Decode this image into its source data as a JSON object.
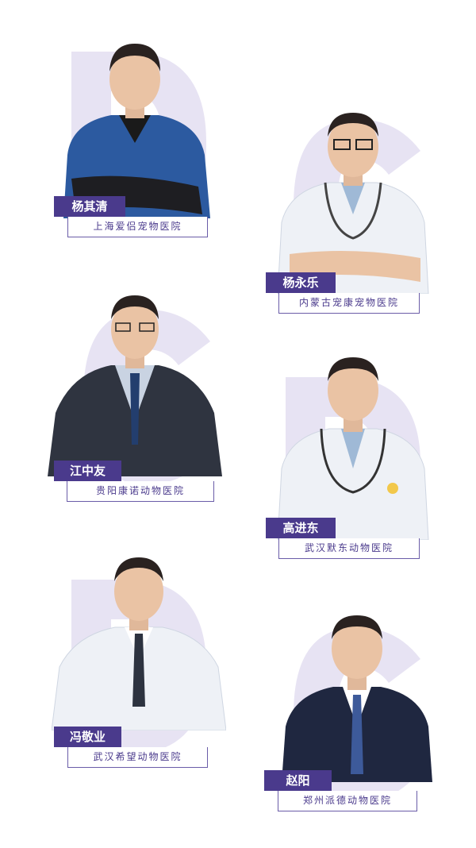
{
  "theme": {
    "accent": "#4a3a8c",
    "deco": "#e7e3f3",
    "blue_coat": "#2c5aa0",
    "white_coat": "#eef1f6",
    "suit": "#2f3440",
    "navy_suit": "#1f2740"
  },
  "doctors": [
    {
      "name": "杨其清",
      "hospital": "上海爱侣宠物医院",
      "outfit": "blue-scrubs"
    },
    {
      "name": "杨永乐",
      "hospital": "内蒙古宠康宠物医院",
      "outfit": "white-coat"
    },
    {
      "name": "江中友",
      "hospital": "贵阳康诺动物医院",
      "outfit": "dark-suit"
    },
    {
      "name": "高进东",
      "hospital": "武汉默东动物医院",
      "outfit": "white-coat"
    },
    {
      "name": "冯敬业",
      "hospital": "武汉希望动物医院",
      "outfit": "white-coat"
    },
    {
      "name": "赵阳",
      "hospital": "郑州派德动物医院",
      "outfit": "navy-suit"
    }
  ]
}
